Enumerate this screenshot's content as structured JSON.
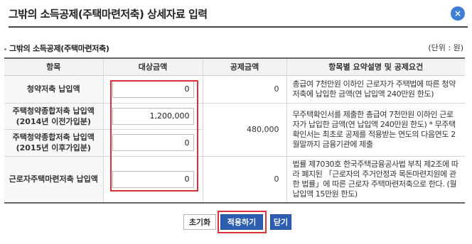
{
  "dialog": {
    "title": "그밖의 소득공제(주택마련저축) 상세자료 입력",
    "close_icon": "×"
  },
  "section": {
    "title": "그밖의 소득공제(주택마련저축)",
    "unit": "(단위 : 원)"
  },
  "table": {
    "headers": [
      "항목",
      "대상금액",
      "공제금액",
      "항목별 요약설명 및 공제요건"
    ],
    "rows": [
      {
        "item": "청약저축 납입액",
        "amount": "0",
        "deduction": "0",
        "desc": "총급여 7천만원 이하인 근로자가 주택법에 따른 청약저축에 납입한 금액(연 납입액 240만원 한도)"
      },
      {
        "item": "주택청약종합저축 납입액 (2014년 이전가입분)",
        "amount": "1,200,000",
        "deduction": "480,000",
        "desc": "무주택확인서를 제출한 총급여 7천만원 이하인 근로자가 납입한 금액(연 납입액 240만원 한도) * 무주택확인서는 최초로 공제를 적용받는 연도의 다음연도 2월말까지 금융기관에 제출"
      },
      {
        "item": "주택청약종합저축 납입액 (2015년 이후가입분)",
        "amount": "0"
      },
      {
        "item": "근로자주택마련저축 납입액",
        "amount": "0",
        "deduction": "0",
        "desc": "법률 제7030호 한국주택금융공사법 부칙 제2조에 따라 폐지된 「근로자의 주거안정과 목돈마련지원에 관한 법률」에 따른 근로자 주택마련저축으로 한다. (월 납입액 15만원 한도)"
      }
    ]
  },
  "buttons": {
    "reset": "초기화",
    "apply": "적용하기",
    "close": "닫기"
  },
  "colors": {
    "accent": "#2c5db0",
    "highlight": "#d9323a",
    "close_circle": "#3f7fd3"
  }
}
